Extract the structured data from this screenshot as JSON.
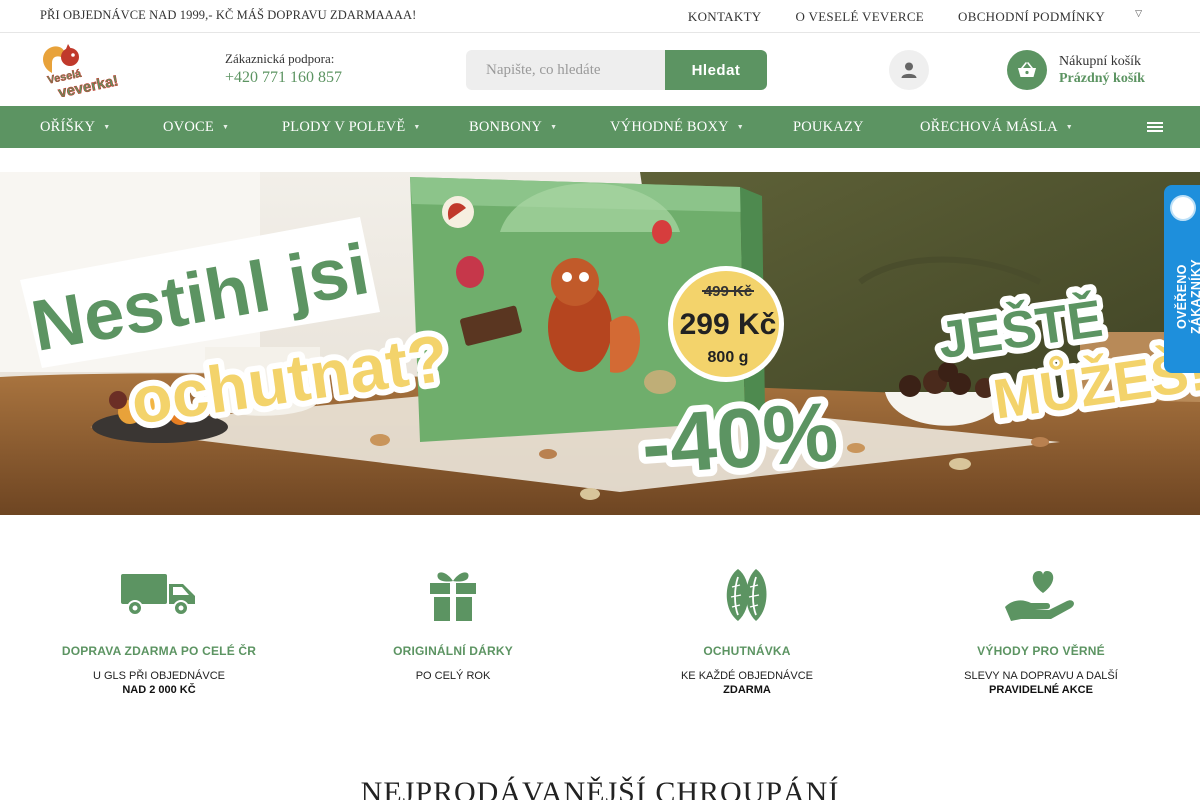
{
  "topbar": {
    "promo": "PŘI OBJEDNÁVCE NAD 1999,- KČ MÁŠ DOPRAVU ZDARMAAAA!",
    "links": [
      "KONTAKTY",
      "O VESELÉ VEVERCE",
      "OBCHODNÍ PODMÍNKY"
    ]
  },
  "header": {
    "logo_text": [
      "Veselá",
      "veverka!"
    ],
    "support_label": "Zákaznická podpora:",
    "support_phone": "+420 771 160 857",
    "search_placeholder": "Napište, co hledáte",
    "search_button": "Hledat",
    "cart_title": "Nákupní košík",
    "cart_status": "Prázdný košík"
  },
  "nav": {
    "items": [
      {
        "label": "OŘÍŠKY",
        "has_submenu": true
      },
      {
        "label": "OVOCE",
        "has_submenu": true
      },
      {
        "label": "PLODY V POLEVĚ",
        "has_submenu": true
      },
      {
        "label": "BONBONY",
        "has_submenu": true
      },
      {
        "label": "VÝHODNÉ BOXY",
        "has_submenu": true
      },
      {
        "label": "POUKAZY",
        "has_submenu": false
      },
      {
        "label": "OŘECHOVÁ MÁSLA",
        "has_submenu": true
      }
    ]
  },
  "hero": {
    "line1": "Nestihl jsi",
    "line2": "ochutnat?",
    "old_price": "499 Kč",
    "new_price": "299 Kč",
    "weight": "800 g",
    "discount": "-40%",
    "right1": "JEŠTĚ",
    "right2": "MŮŽEŠ!"
  },
  "side_badge": {
    "text": "OVĚŘENO ZÁKAZNÍKY"
  },
  "benefits": [
    {
      "icon": "truck-icon",
      "title": "DOPRAVA ZDARMA PO CELÉ ČR",
      "line1": "U GLS PŘI OBJEDNÁVCE",
      "line2": "NAD 2 000 KČ"
    },
    {
      "icon": "gift-icon",
      "title": "ORIGINÁLNÍ DÁRKY",
      "line1": "PO CELÝ ROK",
      "line2": ""
    },
    {
      "icon": "almond-icon",
      "title": "OCHUTNÁVKA",
      "line1": "KE KAŽDÉ OBJEDNÁVCE",
      "line2": "ZDARMA"
    },
    {
      "icon": "heart-hand-icon",
      "title": "VÝHODY PRO VĚRNÉ",
      "line1": "SLEVY NA DOPRAVU A DALŠÍ",
      "line2": "PRAVIDELNÉ AKCE"
    }
  ],
  "section_title": "NEJPRODÁVANĚJŠÍ CHROUPÁNÍ",
  "colors": {
    "brand_green": "#5c9462",
    "hero_yellow": "#f3d36b",
    "badge_blue": "#1e8fdc"
  }
}
